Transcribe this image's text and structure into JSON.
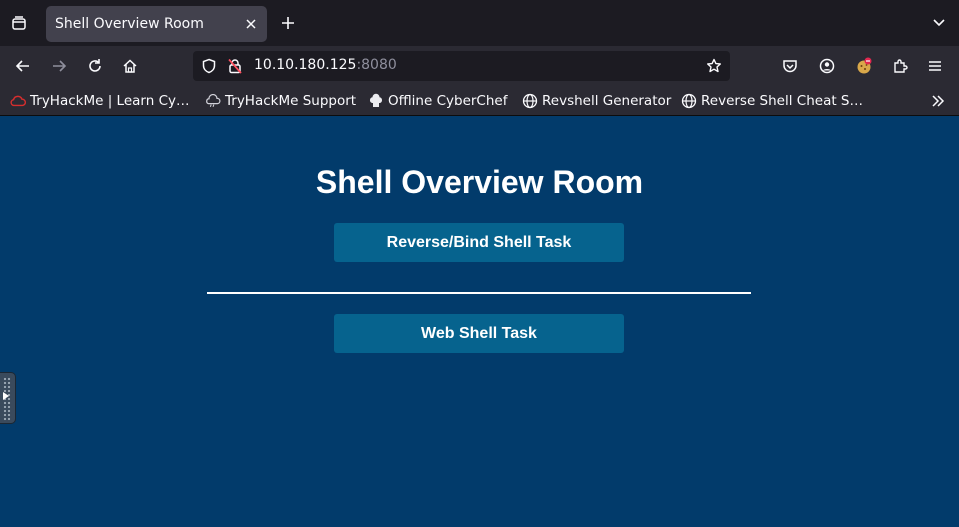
{
  "browser": {
    "tab": {
      "title": "Shell Overview Room"
    },
    "url": {
      "host": "10.10.180.125",
      "port": ":8080"
    },
    "bookmarks": [
      {
        "label": "TryHackMe | Learn Cy…",
        "icon": "tryhackme-cloud-icon"
      },
      {
        "label": "TryHackMe Support",
        "icon": "support-cloud-icon"
      },
      {
        "label": "Offline CyberChef",
        "icon": "chef-hat-icon"
      },
      {
        "label": "Revshell Generator",
        "icon": "globe-icon"
      },
      {
        "label": "Reverse Shell Cheat S…",
        "icon": "globe-icon"
      }
    ]
  },
  "page": {
    "title": "Shell Overview Room",
    "buttons": {
      "reverse_bind": "Reverse/Bind Shell Task",
      "web_shell": "Web Shell Task"
    }
  },
  "colors": {
    "page_background": "#023b6b",
    "button_background": "#06638e",
    "toolbar": "#2b2a33",
    "tabstrip": "#1c1b22"
  }
}
